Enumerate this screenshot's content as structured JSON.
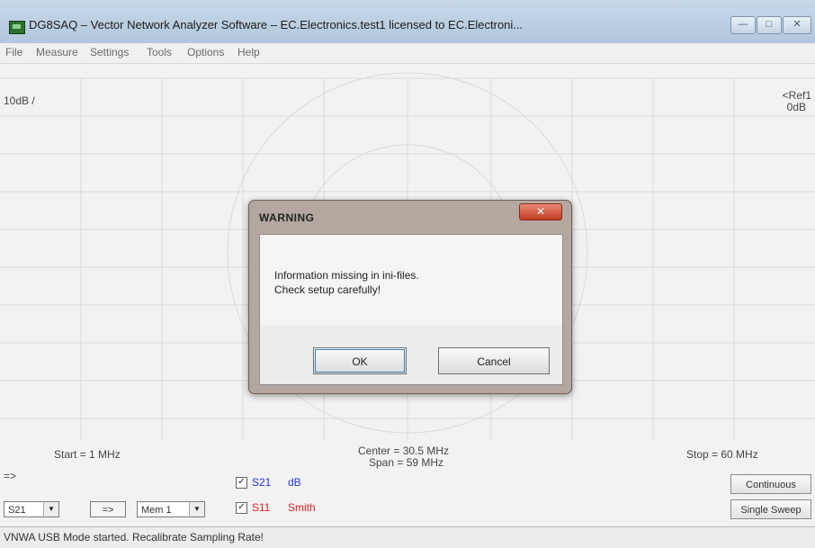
{
  "window": {
    "title": "DG8SAQ  –  Vector Network Analyzer Software  –  EC.Electronics.test1 licensed to EC.Electroni...",
    "minimize_glyph": "—",
    "maximize_glyph": "□",
    "close_glyph": "✕"
  },
  "menu": {
    "items": [
      "File",
      "Measure",
      "Settings",
      "Tools",
      "Options",
      "Help"
    ]
  },
  "plot": {
    "scale_label": "10dB /",
    "ref_label_1": "<Ref1",
    "ref_label_2": "0dB",
    "start_label": "Start = 1 MHz",
    "center_label": "Center = 30.5 MHz",
    "span_label": "Span = 59 MHz",
    "stop_label": "Stop = 60 MHz",
    "arrow_label": "=>"
  },
  "traces": [
    {
      "checked": "✓",
      "name": "S21",
      "format": "dB",
      "color": "#2233dd"
    },
    {
      "checked": "✓",
      "name": "S11",
      "format": "Smith",
      "color": "#dd2222"
    }
  ],
  "controls": {
    "param_select": "S21",
    "transfer_button": "=>",
    "mem_select": "Mem 1",
    "continuous_button": "Continuous",
    "single_sweep_button": "Single Sweep"
  },
  "status": {
    "text": "VNWA USB Mode started.   Recalibrate Sampling Rate!"
  },
  "dialog": {
    "title": "WARNING",
    "close_glyph": "✕",
    "message_line1": "Information missing in ini-files.",
    "message_line2": "Check setup carefully!",
    "ok_label": "OK",
    "cancel_label": "Cancel"
  },
  "colors": {
    "titlebar": "#b8cce0",
    "grid": "#d9d9d9",
    "s21": "#2233dd",
    "s11": "#dd2222",
    "dialog_close": "#c9442b"
  }
}
